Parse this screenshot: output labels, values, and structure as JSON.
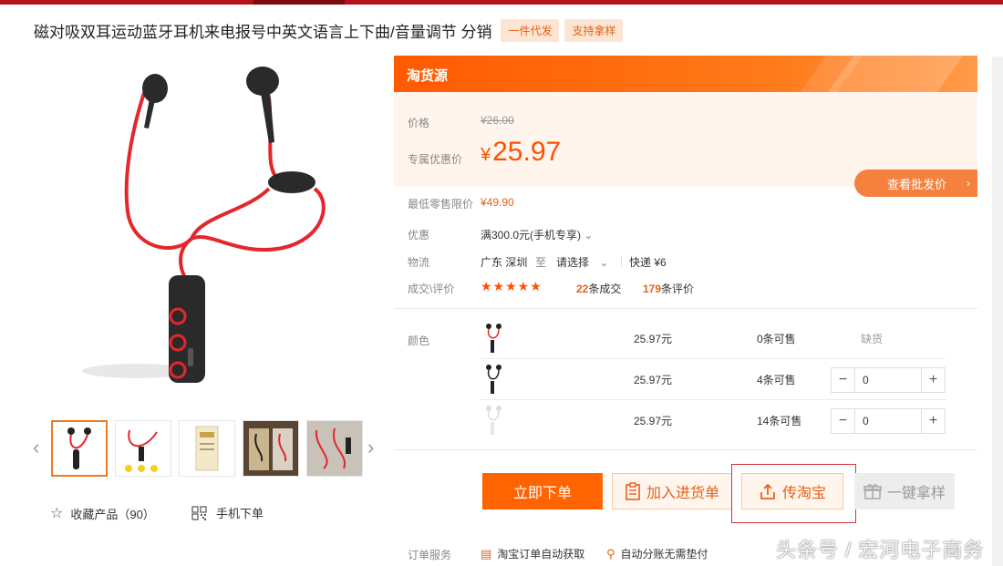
{
  "product": {
    "title": "磁对吸双耳运动蓝牙耳机来电报号中英文语言上下曲/音量调节 分销",
    "tags": [
      "一件代发",
      "支持拿样"
    ]
  },
  "gallery": {
    "favorite_label": "收藏产品（90）",
    "mobile_order_label": "手机下单"
  },
  "pricing": {
    "source_label": "淘货源",
    "price_label": "价格",
    "original_price": "¥26.00",
    "exclusive_label": "专属优惠价",
    "currency_symbol": "¥",
    "exclusive_price": "25.97",
    "wholesale_button": "查看批发价",
    "min_retail_label": "最低零售限价",
    "min_retail_price": "¥49.90"
  },
  "info": {
    "discount_label": "优惠",
    "discount_value": "满300.0元(手机专享)",
    "logistics_label": "物流",
    "origin": "广东 深圳",
    "to": "至",
    "destination": "请选择",
    "shipping": "快递 ¥6",
    "deals_label": "成交\\评价",
    "rating_stars": "★★★★★",
    "deals_count": "22",
    "deals_suffix": "条成交",
    "reviews_count": "179",
    "reviews_suffix": "条评价"
  },
  "sku": {
    "color_label": "颜色",
    "rows": [
      {
        "price": "25.97元",
        "stock": "0条可售",
        "status": "缺货"
      },
      {
        "price": "25.97元",
        "stock": "4条可售",
        "qty": "0"
      },
      {
        "price": "25.97元",
        "stock": "14条可售",
        "qty": "0"
      }
    ]
  },
  "actions": {
    "order_now": "立即下单",
    "add_to_cart": "加入进货单",
    "upload_taobao": "传淘宝",
    "one_click_sample": "一键拿样"
  },
  "service": {
    "label": "订单服务",
    "items": [
      "淘宝订单自动获取",
      "自动分账无需垫付"
    ]
  },
  "watermark": "头条号 / 宏河电子商务",
  "colors": {
    "brand_orange": "#ff5000",
    "top_bar": "#b4121b",
    "highlight": "#c8373b"
  }
}
